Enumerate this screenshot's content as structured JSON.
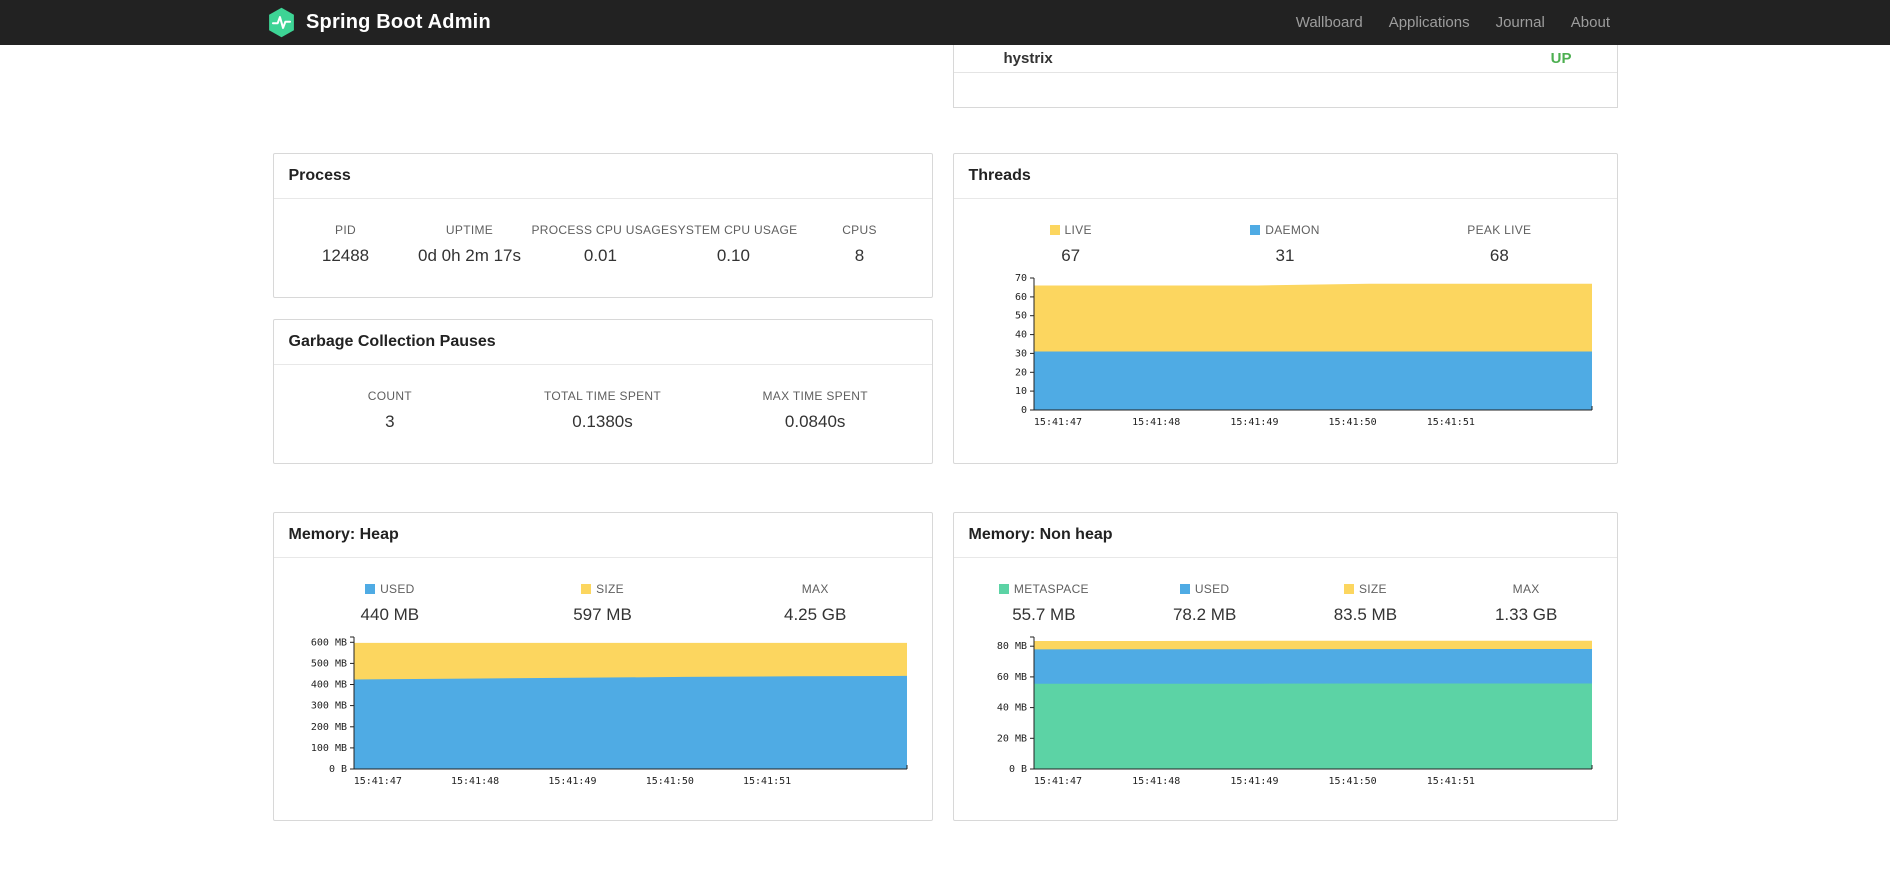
{
  "navbar": {
    "brand": "Spring Boot Admin",
    "links": [
      "Wallboard",
      "Applications",
      "Journal",
      "About"
    ]
  },
  "status_panel": {
    "application": "hystrix",
    "status": "UP",
    "status_color": "#4caf50"
  },
  "process": {
    "title": "Process",
    "stats": [
      {
        "label": "PID",
        "value": "12488"
      },
      {
        "label": "UPTIME",
        "value": "0d 0h 2m 17s"
      },
      {
        "label": "PROCESS CPU USAGE",
        "value": "0.01"
      },
      {
        "label": "SYSTEM CPU USAGE",
        "value": "0.10"
      },
      {
        "label": "CPUS",
        "value": "8"
      }
    ]
  },
  "gc": {
    "title": "Garbage Collection Pauses",
    "stats": [
      {
        "label": "COUNT",
        "value": "3"
      },
      {
        "label": "TOTAL TIME SPENT",
        "value": "0.1380s"
      },
      {
        "label": "MAX TIME SPENT",
        "value": "0.0840s"
      }
    ]
  },
  "threads": {
    "title": "Threads",
    "stats": [
      {
        "label": "LIVE",
        "value": "67",
        "swatch": "#fcd65f"
      },
      {
        "label": "DAEMON",
        "value": "31",
        "swatch": "#4fabe4"
      },
      {
        "label": "PEAK LIVE",
        "value": "68"
      }
    ]
  },
  "heap": {
    "title": "Memory: Heap",
    "stats": [
      {
        "label": "USED",
        "value": "440 MB",
        "swatch": "#4fabe4"
      },
      {
        "label": "SIZE",
        "value": "597 MB",
        "swatch": "#fcd65f"
      },
      {
        "label": "MAX",
        "value": "4.25 GB"
      }
    ]
  },
  "nonheap": {
    "title": "Memory: Non heap",
    "stats": [
      {
        "label": "METASPACE",
        "value": "55.7 MB",
        "swatch": "#5cd3a5"
      },
      {
        "label": "USED",
        "value": "78.2 MB",
        "swatch": "#4fabe4"
      },
      {
        "label": "SIZE",
        "value": "83.5 MB",
        "swatch": "#fcd65f"
      },
      {
        "label": "MAX",
        "value": "1.33 GB"
      }
    ]
  },
  "chart_data": [
    {
      "id": "threads",
      "type": "area",
      "title": "Threads",
      "x": [
        "15:41:47",
        "15:41:48",
        "15:41:49",
        "15:41:50",
        "15:41:51"
      ],
      "ylim": [
        0,
        70
      ],
      "cap": false,
      "yticks": [
        {
          "v": 0,
          "label": "0"
        },
        {
          "v": 10,
          "label": "10"
        },
        {
          "v": 20,
          "label": "20"
        },
        {
          "v": 30,
          "label": "30"
        },
        {
          "v": 40,
          "label": "40"
        },
        {
          "v": 50,
          "label": "50"
        },
        {
          "v": 60,
          "label": "60"
        },
        {
          "v": 70,
          "label": "70"
        }
      ],
      "series": [
        {
          "name": "LIVE",
          "color": "#fcd65f",
          "values": [
            66,
            66,
            66,
            67,
            67,
            67
          ]
        },
        {
          "name": "DAEMON",
          "color": "#4fabe4",
          "values": [
            31,
            31,
            31,
            31,
            31,
            31
          ]
        }
      ],
      "legend": [
        {
          "name": "LIVE",
          "value": 67
        },
        {
          "name": "DAEMON",
          "value": 31
        },
        {
          "name": "PEAK LIVE",
          "value": 68
        }
      ]
    },
    {
      "id": "memory-heap",
      "type": "area",
      "title": "Memory: Heap (MB)",
      "x": [
        "15:41:47",
        "15:41:48",
        "15:41:49",
        "15:41:50",
        "15:41:51"
      ],
      "ylim": [
        0,
        625
      ],
      "cap": true,
      "yticks": [
        {
          "v": 0,
          "label": "0 B"
        },
        {
          "v": 100,
          "label": "100 MB"
        },
        {
          "v": 200,
          "label": "200 MB"
        },
        {
          "v": 300,
          "label": "300 MB"
        },
        {
          "v": 400,
          "label": "400 MB"
        },
        {
          "v": 500,
          "label": "500 MB"
        },
        {
          "v": 600,
          "label": "600 MB"
        }
      ],
      "series": [
        {
          "name": "SIZE",
          "color": "#fcd65f",
          "values": [
            597,
            597,
            597,
            597,
            597,
            597
          ]
        },
        {
          "name": "USED",
          "color": "#4fabe4",
          "values": [
            424,
            428,
            432,
            436,
            439,
            441
          ]
        }
      ],
      "legend": [
        {
          "name": "USED",
          "value": "440 MB"
        },
        {
          "name": "SIZE",
          "value": "597 MB"
        },
        {
          "name": "MAX",
          "value": "4.25 GB"
        }
      ]
    },
    {
      "id": "memory-nonheap",
      "type": "area",
      "title": "Memory: Non heap (MB)",
      "x": [
        "15:41:47",
        "15:41:48",
        "15:41:49",
        "15:41:50",
        "15:41:51"
      ],
      "ylim": [
        0,
        86
      ],
      "cap": true,
      "yticks": [
        {
          "v": 0,
          "label": "0 B"
        },
        {
          "v": 20,
          "label": "20 MB"
        },
        {
          "v": 40,
          "label": "40 MB"
        },
        {
          "v": 60,
          "label": "60 MB"
        },
        {
          "v": 80,
          "label": "80 MB"
        }
      ],
      "series": [
        {
          "name": "SIZE",
          "color": "#fcd65f",
          "values": [
            83.4,
            83.4,
            83.5,
            83.5,
            83.5,
            83.5
          ]
        },
        {
          "name": "USED",
          "color": "#4fabe4",
          "values": [
            77.9,
            78.0,
            78.0,
            78.1,
            78.2,
            78.2
          ]
        },
        {
          "name": "METASPACE",
          "color": "#5cd3a5",
          "values": [
            55.5,
            55.6,
            55.6,
            55.7,
            55.7,
            55.7
          ]
        }
      ],
      "legend": [
        {
          "name": "METASPACE",
          "value": "55.7 MB"
        },
        {
          "name": "USED",
          "value": "78.2 MB"
        },
        {
          "name": "SIZE",
          "value": "83.5 MB"
        },
        {
          "name": "MAX",
          "value": "1.33 GB"
        }
      ]
    }
  ]
}
